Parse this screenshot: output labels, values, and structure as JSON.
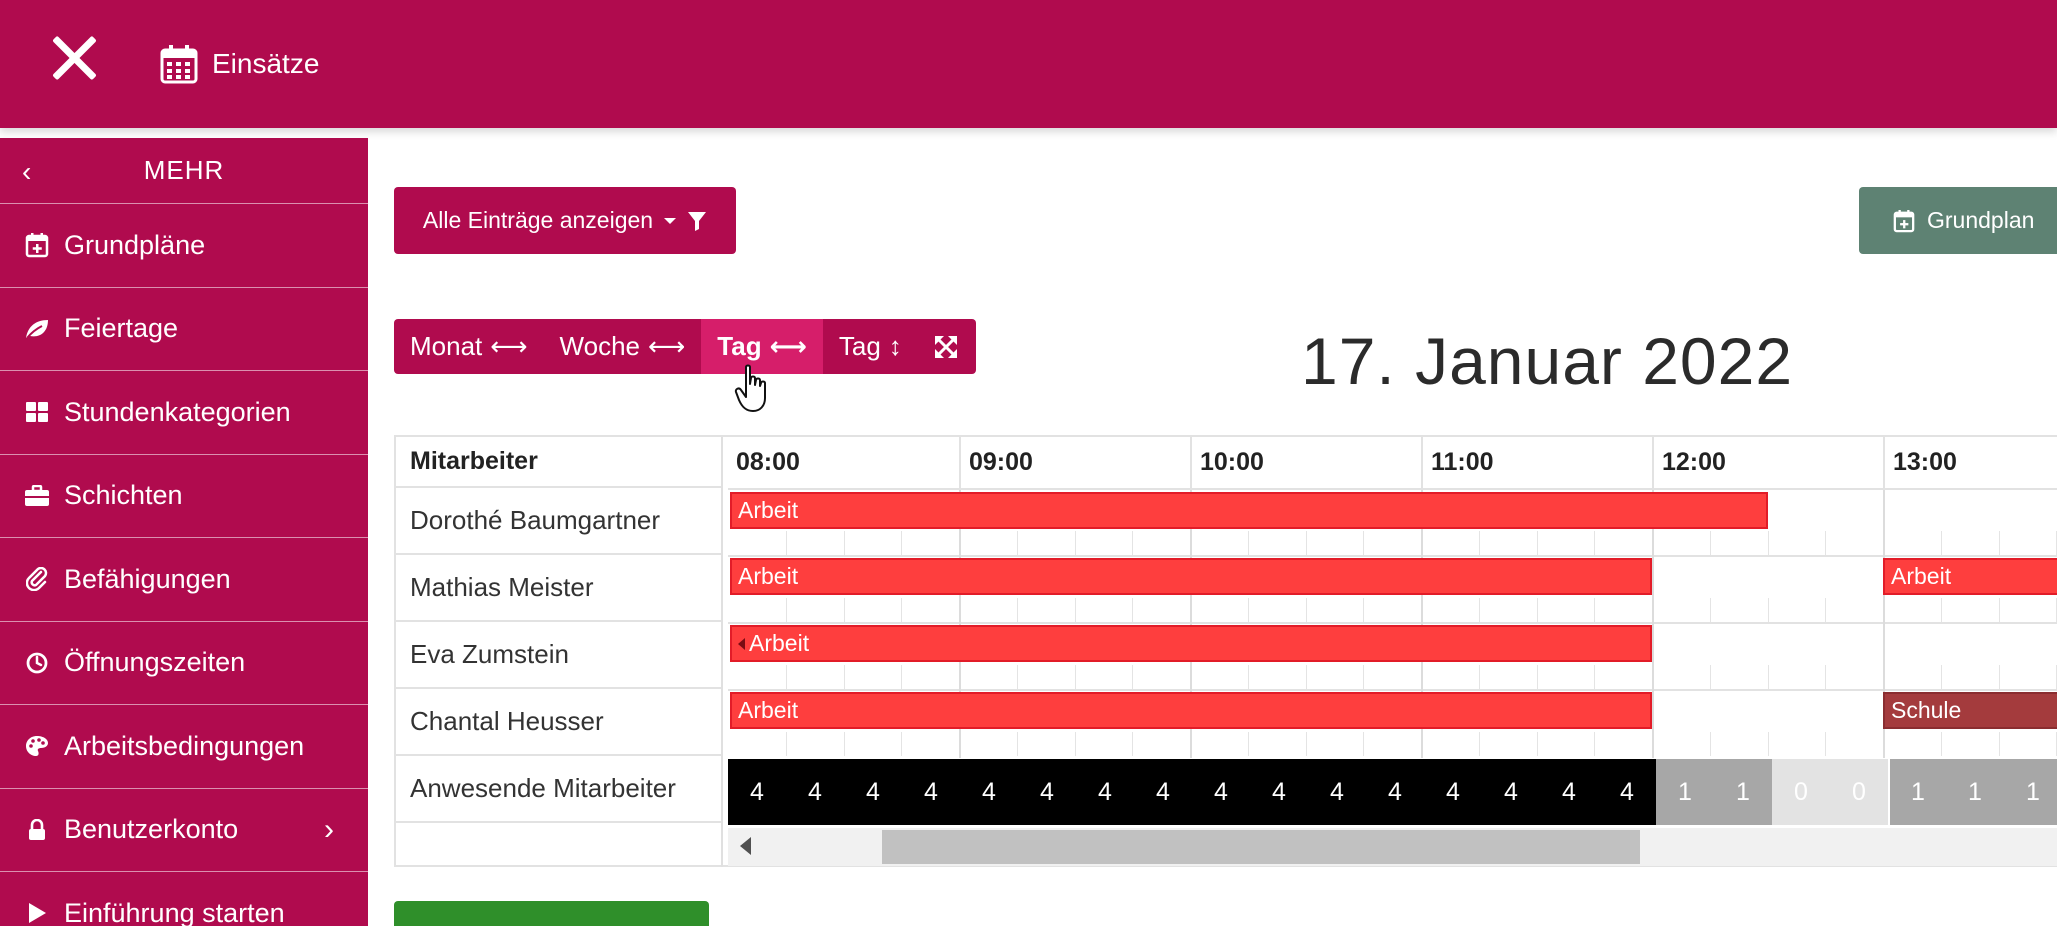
{
  "topbar": {
    "title": "Einsätze",
    "close_icon": "close-icon",
    "title_icon": "calendar-icon",
    "color": "#b00b4e"
  },
  "sidebar": {
    "header": "MEHR",
    "items": [
      {
        "label": "Grundpläne",
        "icon": "calendar-plus-icon"
      },
      {
        "label": "Feiertage",
        "icon": "leaf-icon"
      },
      {
        "label": "Stundenkategorien",
        "icon": "grid-icon"
      },
      {
        "label": "Schichten",
        "icon": "briefcase-icon"
      },
      {
        "label": "Befähigungen",
        "icon": "paperclip-icon"
      },
      {
        "label": "Öffnungszeiten",
        "icon": "clock-icon"
      },
      {
        "label": "Arbeitsbedingungen",
        "icon": "palette-icon"
      },
      {
        "label": "Benutzerkonto",
        "icon": "lock-icon"
      },
      {
        "label": "Einführung starten",
        "icon": "play-icon"
      }
    ]
  },
  "toolbar": {
    "filter_label": "Alle Einträge anzeigen",
    "grundplan_label": "Grundplan"
  },
  "views": {
    "month": "Monat",
    "week": "Woche",
    "day_horizontal": "Tag",
    "day_vertical": "Tag",
    "active": "day_horizontal"
  },
  "date_title": "17. Januar 2022",
  "schedule": {
    "employee_header": "Mitarbeiter",
    "hours": [
      "08:00",
      "09:00",
      "10:00",
      "11:00",
      "12:00",
      "13:00"
    ],
    "employees": [
      {
        "name": "Dorothé Baumgartner",
        "entries": [
          {
            "label": "Arbeit",
            "type": "work"
          }
        ]
      },
      {
        "name": "Mathias Meister",
        "entries": [
          {
            "label": "Arbeit",
            "type": "work"
          },
          {
            "label": "Arbeit",
            "type": "work"
          }
        ]
      },
      {
        "name": "Eva Zumstein",
        "entries": [
          {
            "label": "Arbeit",
            "type": "work"
          }
        ]
      },
      {
        "name": "Chantal Heusser",
        "entries": [
          {
            "label": "Arbeit",
            "type": "work"
          },
          {
            "label": "Schule",
            "type": "school"
          }
        ]
      }
    ],
    "present_label": "Anwesende Mitarbeiter",
    "present_counts": [
      4,
      4,
      4,
      4,
      4,
      4,
      4,
      4,
      4,
      4,
      4,
      4,
      4,
      4,
      4,
      4,
      1,
      1,
      0,
      0,
      1,
      1,
      1
    ]
  },
  "colors": {
    "brand": "#b00b4e",
    "brand_active": "#d61e6a",
    "work_bar": "#fe3e3e",
    "school_bar": "#a43b3d",
    "grundplan_button": "#5e8273"
  }
}
